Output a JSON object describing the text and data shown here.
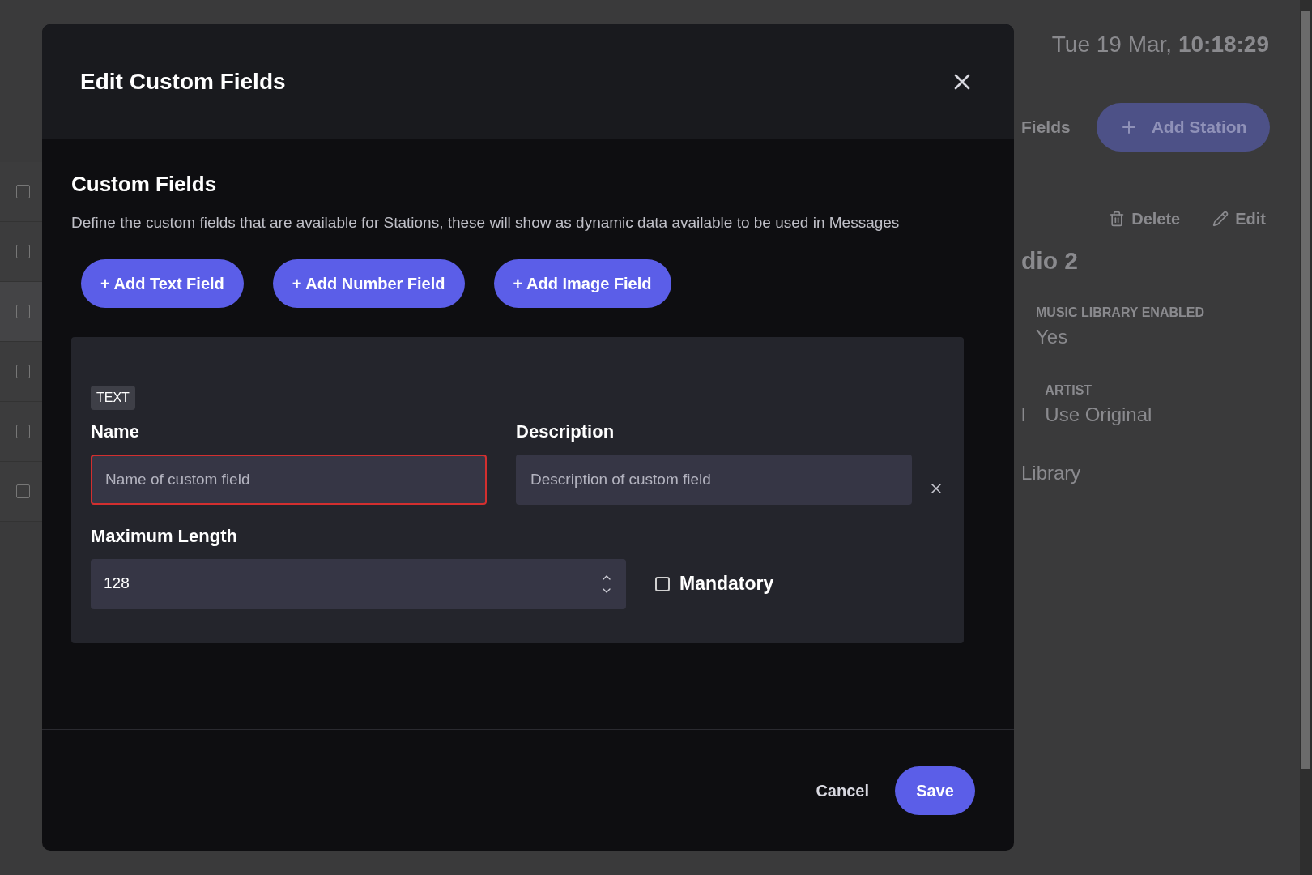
{
  "background": {
    "date": "Tue 19 Mar, ",
    "time": "10:18:29",
    "tab_partial": "Fields",
    "add_button": "Add Station",
    "actions": [
      {
        "kind": "delete",
        "label": "Delete"
      },
      {
        "kind": "edit",
        "label": "Edit"
      }
    ],
    "station_name": "dio 2",
    "detail_rows": [
      [
        {
          "label": "MUSIC LIBRARY ENABLED",
          "value": "Yes"
        }
      ],
      [
        {
          "value": "l"
        },
        {
          "label": "ARTIST",
          "value": "Use Original"
        }
      ],
      [
        {
          "value": "Library"
        }
      ]
    ],
    "rows": [
      {
        "checked": false
      },
      {
        "checked": false
      },
      {
        "checked": false
      },
      {
        "checked": false
      },
      {
        "checked": false
      },
      {
        "checked": false
      }
    ]
  },
  "dialog": {
    "title": "Edit Custom Fields",
    "section_title": "Custom Fields",
    "description": "Define the custom fields that are available for Stations, these will show as dynamic data available to be used in Messages",
    "add_buttons": [
      "+ Add Text Field",
      "+ Add Number Field",
      "+ Add Image Field"
    ],
    "fields": [
      {
        "kind": "text",
        "type_label": "TEXT",
        "name": {
          "label": "Name",
          "placeholder": "Name of custom field",
          "invalid": true
        },
        "description": {
          "label": "Description",
          "placeholder": "Description of custom field",
          "invalid": false
        },
        "max_length": {
          "label": "Maximum Length",
          "value": "128"
        },
        "mandatory": {
          "label": "Mandatory",
          "checked": false
        }
      }
    ],
    "cancel": "Cancel",
    "save": "Save"
  }
}
